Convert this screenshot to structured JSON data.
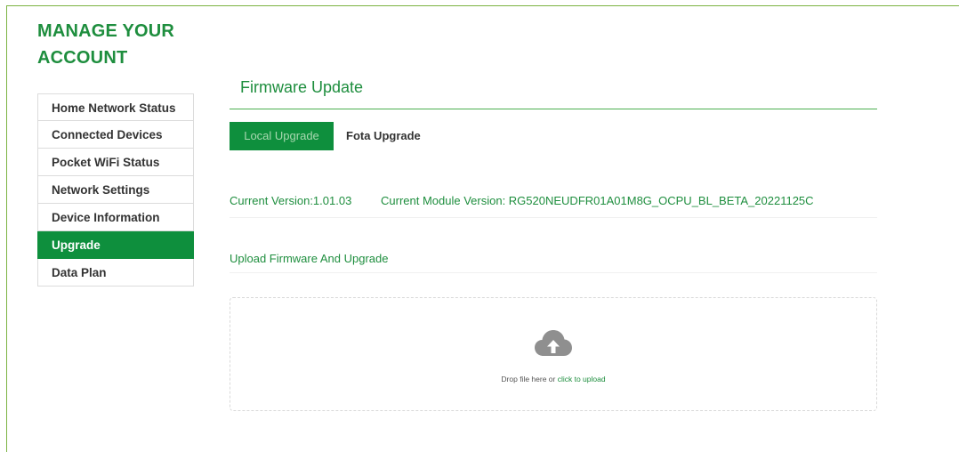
{
  "account": {
    "title_line1": "MANAGE YOUR",
    "title_line2": "ACCOUNT"
  },
  "sidebar": {
    "items": [
      {
        "label": "Home Network Status"
      },
      {
        "label": "Connected Devices"
      },
      {
        "label": "Pocket WiFi Status"
      },
      {
        "label": "Network Settings"
      },
      {
        "label": "Device Information"
      },
      {
        "label": "Upgrade",
        "active": true
      },
      {
        "label": "Data Plan"
      }
    ]
  },
  "main": {
    "title": "Firmware Update",
    "tabs": [
      {
        "label": "Local Upgrade",
        "active": true
      },
      {
        "label": "Fota Upgrade"
      }
    ],
    "current_version": "Current Version:1.01.03",
    "module_version": "Current Module Version: RG520NEUDFR01A01M8G_OCPU_BL_BETA_20221125C",
    "upload_heading": "Upload Firmware And Upgrade",
    "dropzone": {
      "icon": "cloud-upload-icon",
      "text": "Drop file here or ",
      "link_text": "click to upload"
    }
  },
  "colors": {
    "accent": "#0e8f3d",
    "text_green": "#1e8e3e",
    "frame_border": "#7cb342"
  }
}
